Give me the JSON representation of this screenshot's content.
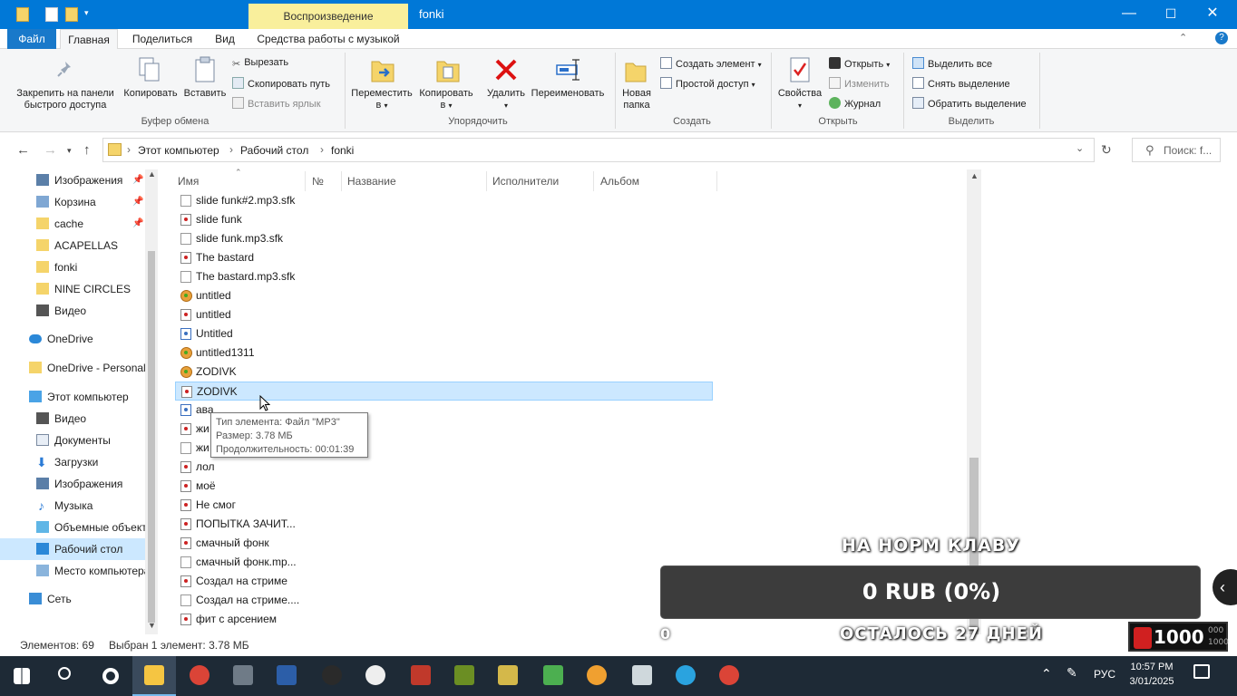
{
  "window": {
    "title": "fonki",
    "context_tab": "Воспроизведение",
    "controls": {
      "minimize": "—",
      "maximize": "☐",
      "close": "✕"
    }
  },
  "tabs": [
    "Файл",
    "Главная",
    "Поделиться",
    "Вид",
    "Средства работы с музыкой"
  ],
  "ribbon": {
    "clipboard": {
      "pin": "Закрепить на панели быстрого доступа",
      "pin_l1": "Закрепить на панели",
      "pin_l2": "быстрого доступа",
      "copy": "Копировать",
      "paste": "Вставить",
      "cut": "Вырезать",
      "copy_path": "Скопировать путь",
      "paste_shortcut": "Вставить ярлык",
      "group": "Буфер обмена"
    },
    "organize": {
      "move_l1": "Переместить",
      "move_l2": "в",
      "copy_l1": "Копировать",
      "copy_l2": "в",
      "delete": "Удалить",
      "rename": "Переименовать",
      "group": "Упорядочить"
    },
    "create": {
      "new_folder_l1": "Новая",
      "new_folder_l2": "папка",
      "new_item": "Создать элемент",
      "easy_access": "Простой доступ",
      "group": "Создать"
    },
    "open": {
      "properties": "Свойства",
      "open": "Открыть",
      "edit": "Изменить",
      "history": "Журнал",
      "group": "Открыть"
    },
    "select": {
      "select_all": "Выделить все",
      "select_none": "Снять выделение",
      "invert": "Обратить выделение",
      "group": "Выделить"
    }
  },
  "address": {
    "crumbs": [
      "Этот компьютер",
      "Рабочий стол",
      "fonki"
    ],
    "sep": "›",
    "search_placeholder": "Поиск: f..."
  },
  "sidebar": {
    "items": [
      {
        "label": "Изображения",
        "icon": "pictures-icon",
        "pinned": true
      },
      {
        "label": "Корзина",
        "icon": "recycle-bin-icon",
        "pinned": true
      },
      {
        "label": "cache",
        "icon": "folder-icon",
        "pinned": true
      },
      {
        "label": "ACAPELLAS",
        "icon": "folder-icon"
      },
      {
        "label": "fonki",
        "icon": "folder-icon"
      },
      {
        "label": "NINE CIRCLES",
        "icon": "folder-icon"
      },
      {
        "label": "Видео",
        "icon": "video-icon"
      },
      {
        "label": "OneDrive",
        "icon": "onedrive-icon"
      },
      {
        "label": "OneDrive - Personal",
        "icon": "folder-icon"
      },
      {
        "label": "Этот компьютер",
        "icon": "computer-icon"
      },
      {
        "label": "Видео",
        "icon": "video-icon"
      },
      {
        "label": "Документы",
        "icon": "documents-icon"
      },
      {
        "label": "Загрузки",
        "icon": "downloads-icon"
      },
      {
        "label": "Изображения",
        "icon": "pictures-icon"
      },
      {
        "label": "Музыка",
        "icon": "music-icon"
      },
      {
        "label": "Объемные объект",
        "icon": "3d-objects-icon"
      },
      {
        "label": "Рабочий стол",
        "icon": "desktop-icon",
        "selected": true
      },
      {
        "label": "Место компьютера",
        "icon": "network-location-icon"
      },
      {
        "label": "Сеть",
        "icon": "network-icon"
      }
    ]
  },
  "columns": [
    "Имя",
    "№",
    "Название",
    "Исполнители",
    "Альбом"
  ],
  "files": [
    {
      "name": "slide funk#2.mp3.sfk",
      "type": "sfk"
    },
    {
      "name": "slide funk",
      "type": "mp3"
    },
    {
      "name": "slide funk.mp3.sfk",
      "type": "sfk"
    },
    {
      "name": "The bastard",
      "type": "mp3"
    },
    {
      "name": "The bastard.mp3.sfk",
      "type": "sfk"
    },
    {
      "name": "untitled",
      "type": "flp"
    },
    {
      "name": "untitled",
      "type": "mp3"
    },
    {
      "name": "Untitled",
      "type": "wav"
    },
    {
      "name": "untitled1311",
      "type": "flp"
    },
    {
      "name": "ZODIVK",
      "type": "flp"
    },
    {
      "name": "ZODIVK",
      "type": "mp3",
      "selected": true
    },
    {
      "name": "ава",
      "type": "wav"
    },
    {
      "name": "жи",
      "type": "mp3"
    },
    {
      "name": "жи",
      "type": "sfk"
    },
    {
      "name": "лол",
      "type": "mp3"
    },
    {
      "name": "моё",
      "type": "mp3"
    },
    {
      "name": "Не смог",
      "type": "mp3"
    },
    {
      "name": "ПОПЫТКА ЗАЧИТ...",
      "type": "mp3"
    },
    {
      "name": "смачный фонк",
      "type": "mp3"
    },
    {
      "name": "смачный фонк.mp...",
      "type": "sfk"
    },
    {
      "name": "Создал на стриме",
      "type": "mp3"
    },
    {
      "name": "Создал на стриме....",
      "type": "sfk"
    },
    {
      "name": "фит с арсением",
      "type": "mp3"
    }
  ],
  "tooltip": {
    "line1": "Тип элемента: Файл \"MP3\"",
    "line2": "Размер: 3.78 МБ",
    "line3": "Продолжительность: 00:01:39"
  },
  "status": {
    "count": "Элементов: 69",
    "selected": "Выбран 1 элемент: 3.78 МБ"
  },
  "overlay": {
    "goal_title": "НА НОРМ КЛАВУ",
    "goal_value": "0 RUB (0%)",
    "days_left": "ОСТАЛОСЬ 27 ДНЕЙ",
    "zero": "0",
    "counter": "1000",
    "counter_small_1": "000",
    "counter_small_2": "1000"
  },
  "taskbar": {
    "apps": [
      "windows-start-icon",
      "search-icon",
      "settings-icon",
      "file-explorer-icon",
      "chrome-icon",
      "calculator-icon",
      "visual-studio-icon",
      "obs-icon",
      "soundcloud-icon",
      "roblox-studio-icon",
      "minecraft-icon",
      "terraria-icon",
      "bluestacks-icon",
      "fl-studio-icon",
      "roblox-icon",
      "telegram-icon",
      "chrome-alt-icon"
    ],
    "lang": "РУС",
    "time": "10:57 PM",
    "date": "3/01/2025"
  },
  "colors": {
    "titlebar": "#0078d7",
    "context_tab": "#f9ef9c",
    "selection": "#cce8ff",
    "taskbar": "#1e2a36"
  }
}
